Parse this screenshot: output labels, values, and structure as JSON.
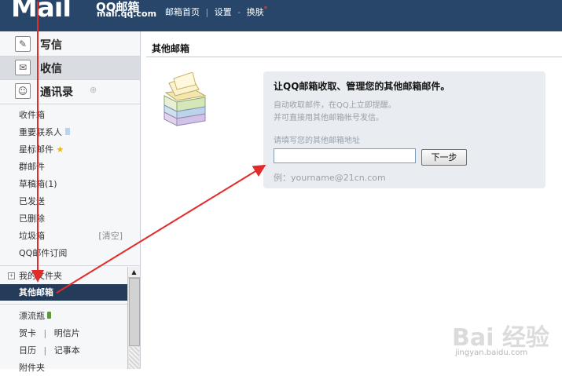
{
  "header": {
    "logo_mark": "Mail",
    "logo_title": "QQ邮箱",
    "logo_domain": "mail.qq.com",
    "nav": [
      "邮箱首页",
      "设置",
      "换肤"
    ],
    "nav_sep": "|",
    "nav_sep2": "-",
    "new_mark": "*"
  },
  "sidebar": {
    "compose": "写信",
    "inbox_btn": "收信",
    "contacts": "通讯录",
    "folders": [
      "收件箱",
      "重要联系人",
      "星标邮件",
      "群邮件",
      "草稿箱(1)",
      "已发送",
      "已删除",
      "垃圾箱",
      "QQ邮件订阅"
    ],
    "trash_clear": "[清空]",
    "my_folders": "我的文件夹",
    "plus": "+",
    "other_mailbox": "其他邮箱",
    "drift_bottle": "漂流瓶",
    "card": "贺卡",
    "postcard": "明信片",
    "calendar": "日历",
    "notebook": "记事本",
    "attachment": "附件夹",
    "pipe": "|"
  },
  "main": {
    "title": "其他邮箱",
    "heading": "让QQ邮箱收取、管理您的其他邮箱邮件。",
    "hint1": "自动收取邮件，在QQ上立即提醒。",
    "hint2": "并可直接用其他邮箱帐号发信。",
    "input_label": "请填写您的其他邮箱地址",
    "input_value": "",
    "next_button": "下一步",
    "example": "例：yourname@21cn.com"
  },
  "watermark": {
    "text": "Bai 经验",
    "url": "jingyan.baidu.com"
  },
  "colors": {
    "header_bg": "#27466a",
    "active_folder_bg": "#243c5a",
    "panel_bg": "#e9edf2",
    "annotation_arrow": "#e32b2b"
  }
}
